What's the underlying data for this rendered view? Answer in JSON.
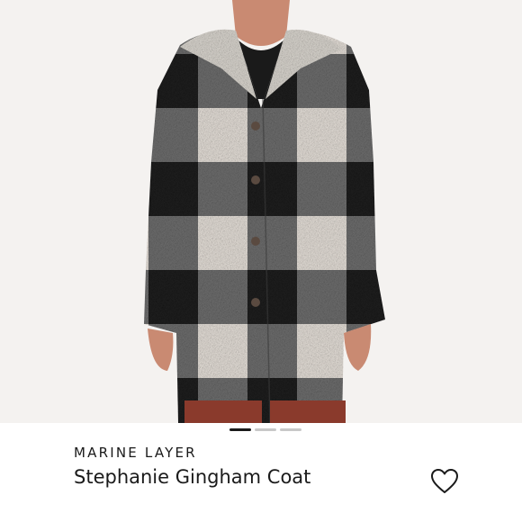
{
  "product": {
    "brand": "MARINE LAYER",
    "name": "Stephanie Gingham Coat",
    "image": {
      "subject": "coat-photo",
      "colors": {
        "background": "#f4f2f0",
        "black_check": "#1f1f1f",
        "grey_check": "#707070",
        "cream_check": "#e9e3dc",
        "collar": "#dedad3",
        "pants": "#8a3a2c",
        "skin": "#c98a72",
        "top": "#1a1a1a"
      }
    },
    "carousel": {
      "slide_count": 3,
      "active_index": 0
    },
    "favorite": {
      "icon": "heart-outline-icon",
      "selected": false
    }
  }
}
